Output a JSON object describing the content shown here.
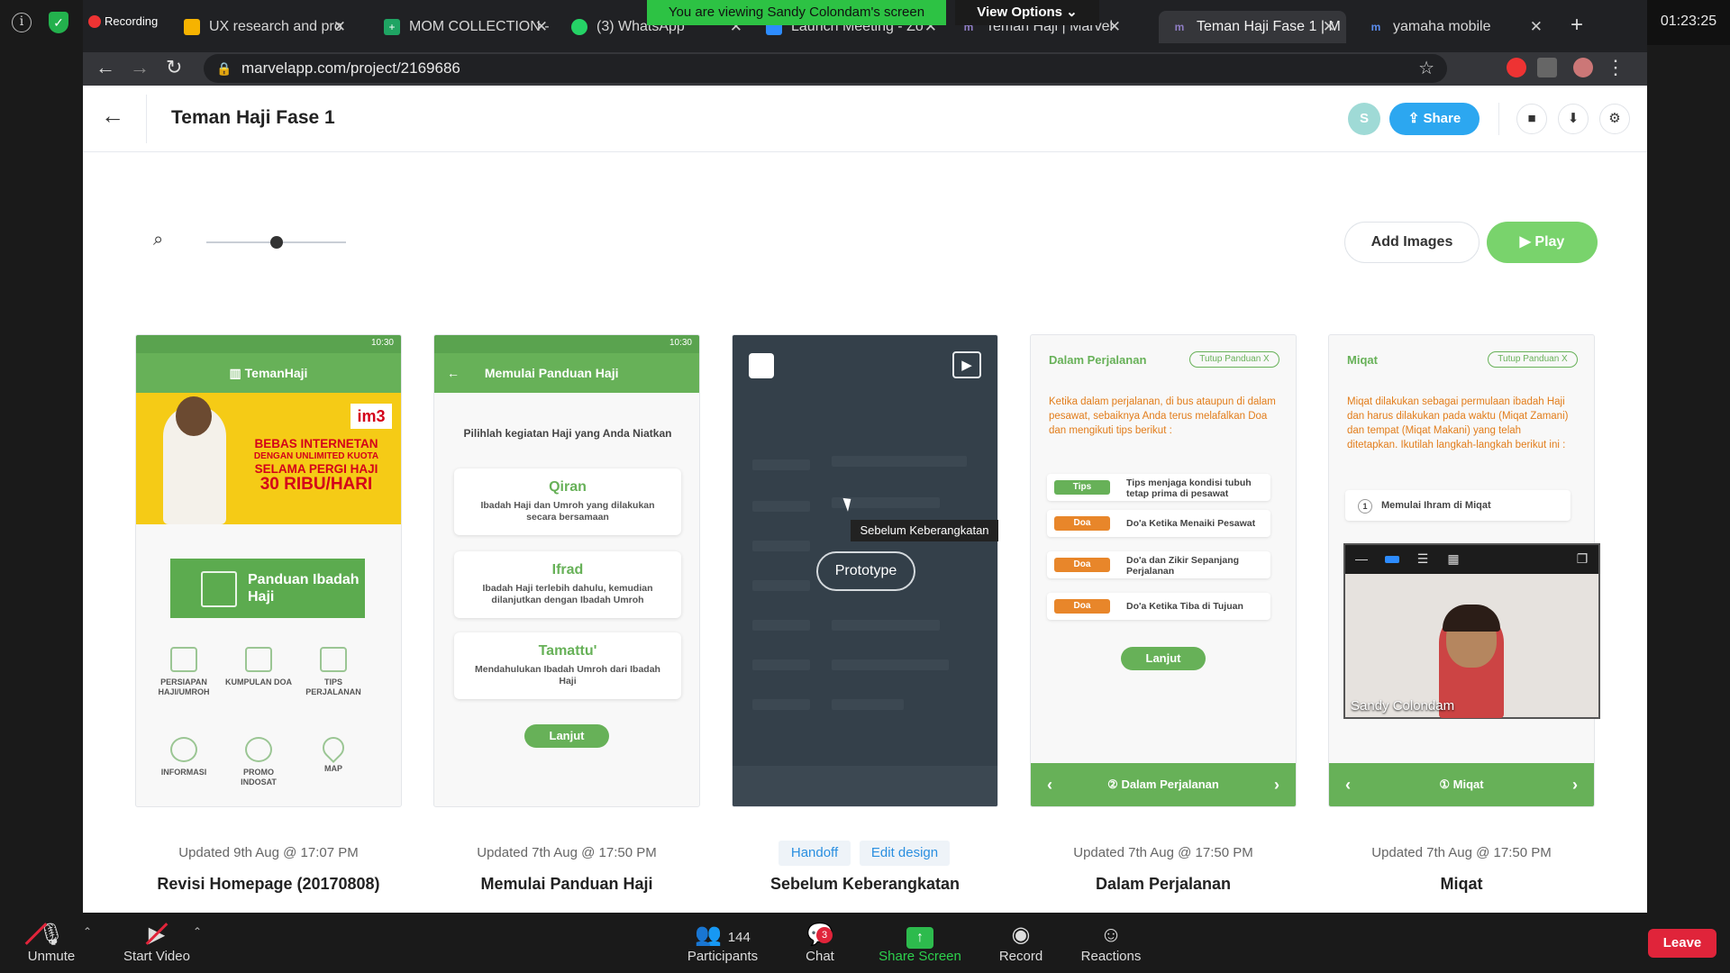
{
  "zoom": {
    "clock": "01:23:25",
    "recording_label": "Recording",
    "viewing_banner": "You are viewing Sandy Colondam's screen",
    "view_options": "View Options ⌄",
    "toolbar": {
      "unmute": "Unmute",
      "start_video": "Start Video",
      "participants": "Participants",
      "participants_count": "144",
      "chat": "Chat",
      "chat_badge": "3",
      "share_screen": "Share Screen",
      "record": "Record",
      "reactions": "Reactions",
      "leave": "Leave"
    },
    "pip": {
      "name": "Sandy Colondam"
    }
  },
  "browser": {
    "tabs": [
      {
        "label": "UX research and pro",
        "icon": "slides-icon",
        "color": "#f6b300"
      },
      {
        "label": "MOM COLLECTION -",
        "icon": "sheets-icon",
        "color": "#1fa463"
      },
      {
        "label": "(3) WhatsApp",
        "icon": "whatsapp-icon",
        "color": "#25d366"
      },
      {
        "label": "Launch Meeting - Zo",
        "icon": "zoom-icon",
        "color": "#2d8cff"
      },
      {
        "label": "Teman Haji | Marvel",
        "icon": "marvel-icon",
        "color": "#8e7cc3"
      },
      {
        "label": "Teman Haji Fase 1 | M",
        "icon": "marvel-icon",
        "color": "#8e7cc3"
      },
      {
        "label": "yamaha mobile",
        "icon": "marvel-icon",
        "color": "#5b8def"
      }
    ],
    "url": "marvelapp.com/project/2169686"
  },
  "app": {
    "title": "Teman Haji Fase 1",
    "avatar_letter": "S",
    "share_label": "Share",
    "add_images": "Add Images",
    "play_label": "Play",
    "tooltip": "Sebelum Keberangkatan",
    "prototype_btn": "Prototype",
    "chips": {
      "handoff": "Handoff",
      "edit_design": "Edit design"
    },
    "zoom_level": 0.5
  },
  "screens": [
    {
      "updated": "Updated 9th Aug @ 17:07 PM",
      "name": "Revisi Homepage (20170808)",
      "status_time": "10:30",
      "brand": "TemanHaji",
      "promo_brand": "im3",
      "promo_line1": "BEBAS INTERNETAN",
      "promo_line2": "DENGAN UNLIMITED KUOTA",
      "promo_line3": "SELAMA PERGI HAJI",
      "promo_line4": "30 RIBU/HARI",
      "guide_button": "Panduan Ibadah Haji",
      "menu": [
        "PERSIAPAN HAJI/UMROH",
        "KUMPULAN DOA",
        "TIPS PERJALANAN",
        "INFORMASI",
        "PROMO INDOSAT",
        "MAP"
      ]
    },
    {
      "updated": "Updated 7th Aug @ 17:50 PM",
      "name": "Memulai Panduan Haji",
      "status_time": "10:30",
      "header": "Memulai Panduan Haji",
      "subtitle": "Pilihlah kegiatan Haji yang Anda Niatkan",
      "options": [
        {
          "title": "Qiran",
          "desc": "Ibadah Haji dan Umroh yang dilakukan secara bersamaan"
        },
        {
          "title": "Ifrad",
          "desc": "Ibadah Haji terlebih dahulu, kemudian dilanjutkan dengan Ibadah Umroh"
        },
        {
          "title": "Tamattu'",
          "desc": "Mendahulukan Ibadah Umroh dari Ibadah Haji"
        }
      ],
      "next": "Lanjut"
    },
    {
      "name": "Sebelum Keberangkatan"
    },
    {
      "updated": "Updated 7th Aug @ 17:50 PM",
      "name": "Dalam Perjalanan",
      "section": "Dalam Perjalanan",
      "close_chip": "Tutup Panduan  X",
      "paragraph": "Ketika dalam perjalanan, di bus ataupun di dalam pesawat, sebaiknya Anda terus melafalkan Doa dan mengikuti tips berikut :",
      "rows": [
        {
          "tag": "Tips",
          "color": "#67b158",
          "text": "Tips menjaga kondisi tubuh tetap prima di pesawat"
        },
        {
          "tag": "Doa",
          "color": "#e8862a",
          "text": "Do'a Ketika Menaiki Pesawat"
        },
        {
          "tag": "Doa",
          "color": "#e8862a",
          "text": "Do'a dan Zikir Sepanjang Perjalanan"
        },
        {
          "tag": "Doa",
          "color": "#e8862a",
          "text": "Do'a Ketika Tiba di Tujuan"
        }
      ],
      "next": "Lanjut",
      "footer": "② Dalam Perjalanan"
    },
    {
      "updated": "Updated 7th Aug @ 17:50 PM",
      "name": "Miqat",
      "section": "Miqat",
      "close_chip": "Tutup Panduan  X",
      "paragraph": "Miqat dilakukan sebagai permulaan ibadah Haji dan harus dilakukan pada waktu (Miqat Zamani) dan tempat (Miqat Makani) yang telah ditetapkan. Ikutilah langkah-langkah berikut ini :",
      "step": "Memulai Ihram di Miqat",
      "step_num": "1",
      "footer": "① Miqat"
    }
  ]
}
